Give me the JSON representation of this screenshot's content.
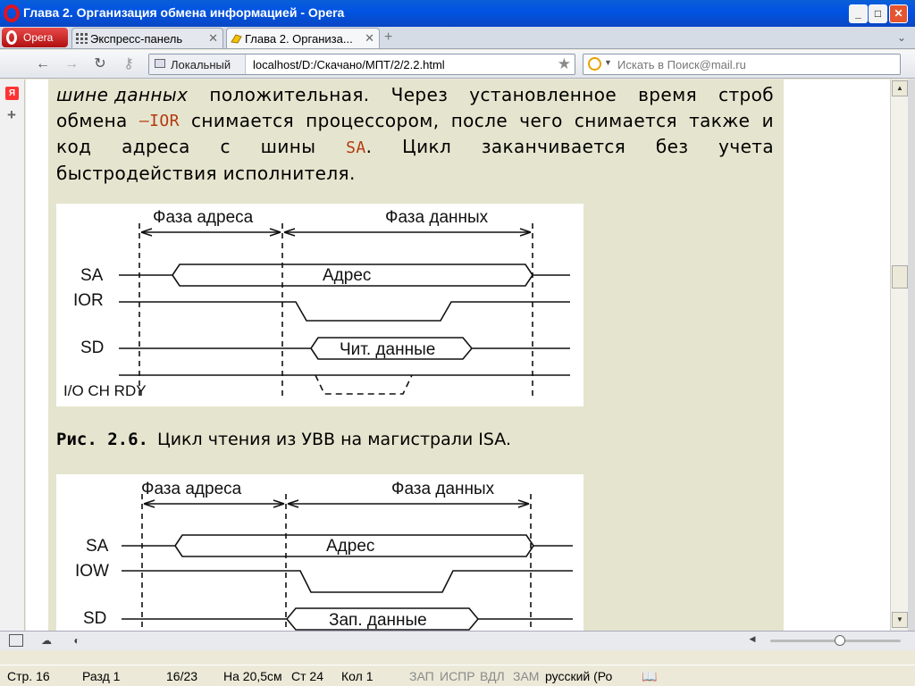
{
  "window": {
    "title": "Глава 2. Организация обмена информацией - Opera"
  },
  "tabs": {
    "menu_label": "Opera",
    "items": [
      {
        "label": "Экспресс-панель"
      },
      {
        "label": "Глава 2. Организа..."
      }
    ]
  },
  "toolbar": {
    "zone_label": "Локальный",
    "url": "localhost/D:/Скачано/МПТ/2/2.2.html",
    "search_placeholder": "Искать в Поиск@mail.ru"
  },
  "article": {
    "line1": [
      "шине данных",
      "положительная.",
      "Через",
      "установленное",
      "время",
      "строб"
    ],
    "line2": [
      "обмена",
      "–IOR",
      "снимается",
      "процессором,",
      "после",
      "чего",
      "снимается",
      "также",
      "и"
    ],
    "line3": [
      "код",
      "адреса",
      "с",
      "шины",
      "SA.",
      "Цикл",
      "заканчивается",
      "без",
      "учета"
    ],
    "line4": "быстродействия исполнителя.",
    "line2_pre": "обмена",
    "line2_code": "–IOR",
    "line3_code": "SA",
    "line1_italic": "шине данных",
    "caption_num": "Рис. 2.6.",
    "caption_text": "Цикл чтения из УВВ на магистрали ISA."
  },
  "figure1": {
    "phase_address": "Фаза адреса",
    "phase_data": "Фаза данных",
    "sig_sa": "SA",
    "sig_ior": "IOR",
    "sig_sd": "SD",
    "sig_rdy": "I/O CH RDY",
    "bus_address": "Адрес",
    "bus_data": "Чит. данные"
  },
  "figure2": {
    "phase_address": "Фаза адреса",
    "phase_data": "Фаза данных",
    "sig_sa": "SA",
    "sig_iow": "IOW",
    "sig_sd": "SD",
    "bus_address": "Адрес",
    "bus_data": "Зап. данные"
  },
  "status": {
    "page": "Стр. 16",
    "section": "Разд 1",
    "pages": "16/23",
    "at": "На 20,5см",
    "line": "Ст 24",
    "col": "Кол 1",
    "rec": "ЗАП",
    "trk": "ИСПР",
    "ext": "ВДЛ",
    "ovr": "ЗАМ",
    "lang": "русский (Ро"
  }
}
